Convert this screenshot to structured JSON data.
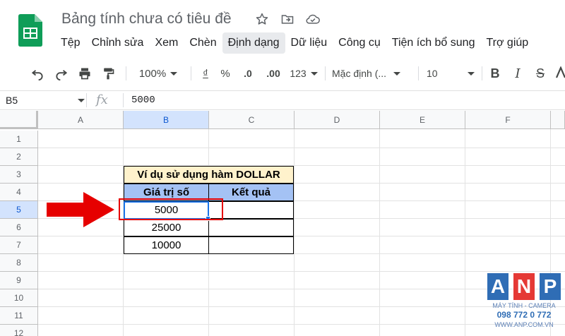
{
  "app": {
    "doc_title": "Bảng tính chưa có tiêu đề",
    "menu": [
      "Tệp",
      "Chỉnh sửa",
      "Xem",
      "Chèn",
      "Định dạng",
      "Dữ liệu",
      "Công cụ",
      "Tiện ích bổ sung",
      "Trợ giúp"
    ],
    "active_menu_index": 4
  },
  "toolbar": {
    "zoom": "100%",
    "currency": "₫",
    "percent": "%",
    "decrease_decimal": ".0",
    "increase_decimal": ".00",
    "more_formats": "123",
    "font": "Mặc định (...",
    "font_size": "10",
    "bold": "B",
    "italic": "I",
    "strike": "S"
  },
  "formula_bar": {
    "name_box": "B5",
    "fx": "fx",
    "content": "5000"
  },
  "grid": {
    "columns": [
      "A",
      "B",
      "C",
      "D",
      "E",
      "F"
    ],
    "rows": [
      "1",
      "2",
      "3",
      "4",
      "5",
      "6",
      "7",
      "8",
      "9",
      "10",
      "11",
      "12"
    ],
    "selected_column": "B",
    "selected_row": "5"
  },
  "table": {
    "title": "Ví dụ sử dụng hàm DOLLAR",
    "headers": [
      "Giá trị số",
      "Kết quả"
    ],
    "values": [
      "5000",
      "25000",
      "10000"
    ]
  },
  "watermark": {
    "letters": [
      "A",
      "N",
      "P"
    ],
    "tagline": "MÁY TÍNH - CAMERA",
    "phone": "098 772 0 772",
    "site": "WWW.ANP.COM.VN",
    "colors": [
      "#2f6db5",
      "#e53935",
      "#2f6db5"
    ]
  },
  "colors": {
    "accent": "#1a73e8",
    "header_fill": "#a4c2f4",
    "title_fill": "#fff2cc",
    "annotation": "#e60000"
  }
}
